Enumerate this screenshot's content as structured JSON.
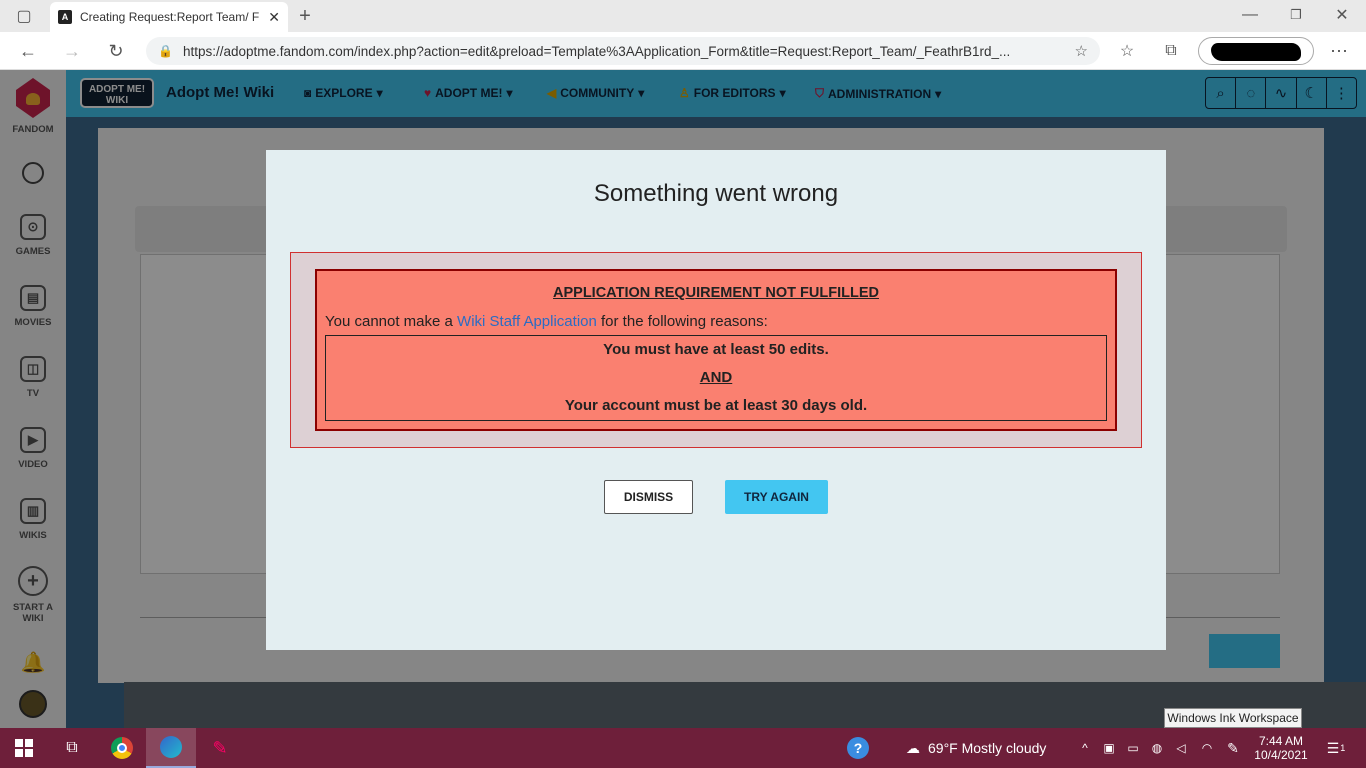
{
  "browser": {
    "tab_title": "Creating Request:Report Team/ F",
    "url": "https://adoptme.fandom.com/index.php?action=edit&preload=Template%3AApplication_Form&title=Request:Report_Team/_FeathrB1rd_..."
  },
  "rail": {
    "brand": "FANDOM",
    "items": [
      {
        "label": "GAMES",
        "icon": "gamepad-icon"
      },
      {
        "label": "MOVIES",
        "icon": "film-icon"
      },
      {
        "label": "TV",
        "icon": "tv-icon"
      },
      {
        "label": "VIDEO",
        "icon": "play-icon"
      },
      {
        "label": "WIKIS",
        "icon": "book-icon"
      },
      {
        "label": "START A WIKI",
        "icon": "plus-icon"
      }
    ]
  },
  "wiki": {
    "logo_text": "ADOPT ME! WIKI",
    "name": "Adopt Me! Wiki",
    "nav": [
      "EXPLORE",
      "ADOPT ME!",
      "COMMUNITY",
      "FOR EDITORS",
      "ADMINISTRATION"
    ]
  },
  "modal": {
    "title": "Something went wrong",
    "heading": "APPLICATION REQUIREMENT NOT FULFILLED",
    "line_prefix": "You cannot make a ",
    "link": "Wiki Staff Application",
    "line_suffix": " for the following reasons:",
    "reason1": "You must have at least 50 edits.",
    "joiner": "AND",
    "reason2": "Your account must be at least 30 days old.",
    "dismiss": "DISMISS",
    "try_again": "TRY AGAIN"
  },
  "taskbar": {
    "weather": "69°F  Mostly cloudy",
    "time": "7:44 AM",
    "date": "10/4/2021",
    "tooltip": "Windows Ink Workspace",
    "notifications": "1"
  },
  "colors": {
    "wiki_accent": "#43c6f1",
    "error_fill": "#fa8070",
    "taskbar": "#6e1f3a"
  }
}
